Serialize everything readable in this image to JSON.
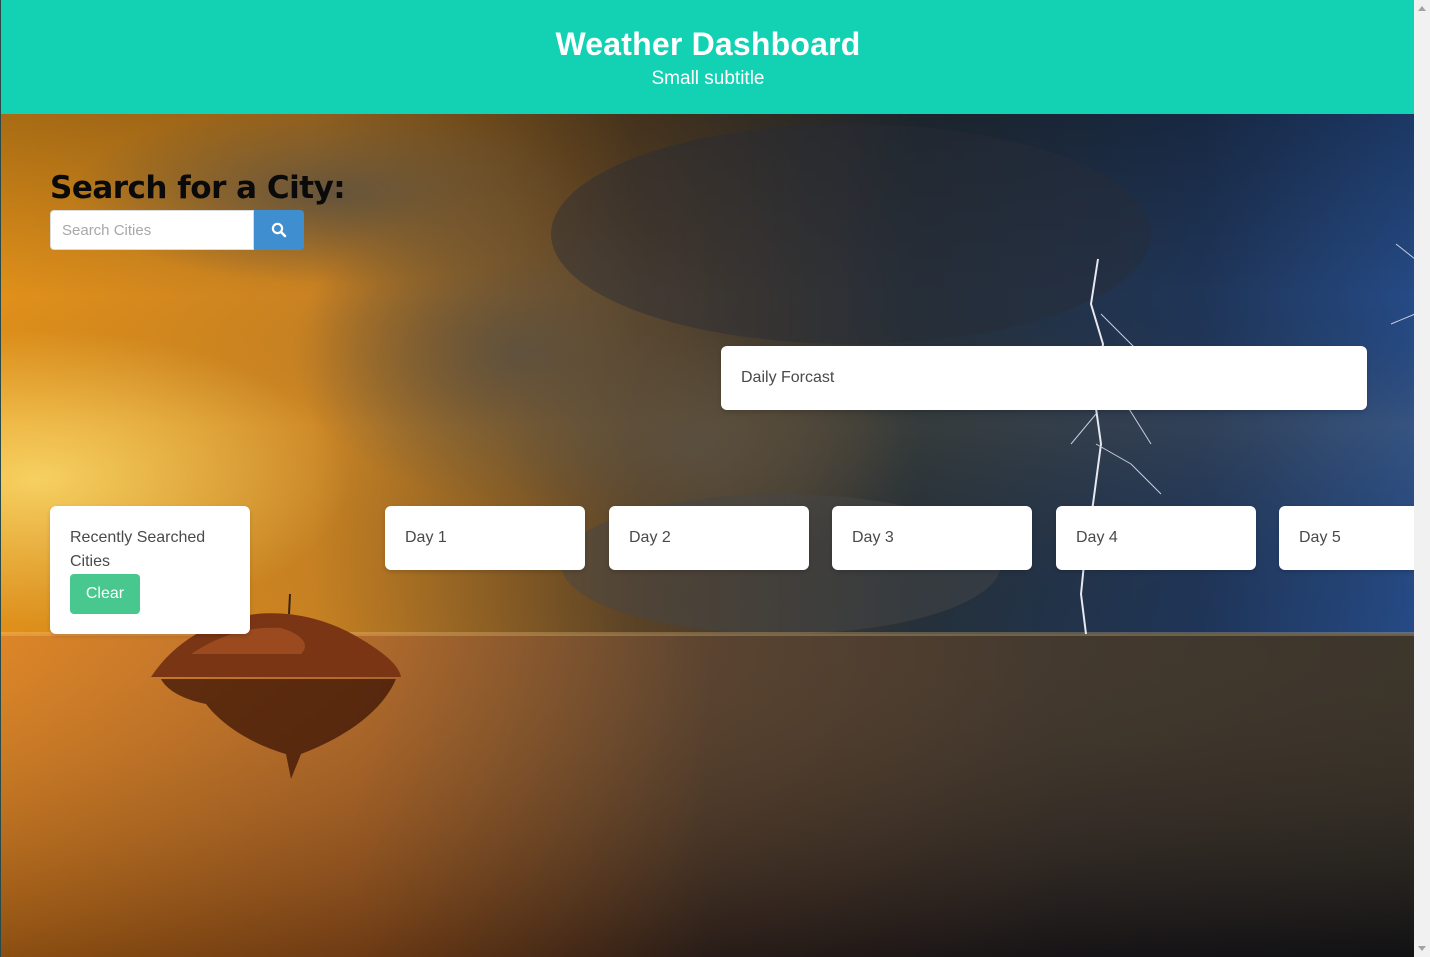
{
  "header": {
    "title": "Weather Dashboard",
    "subtitle": "Small subtitle"
  },
  "search": {
    "heading": "Search for a City:",
    "placeholder": "Search Cities",
    "button_icon": "search-icon"
  },
  "daily": {
    "label": "Daily Forcast"
  },
  "recent": {
    "label": "Recently Searched Cities",
    "clear_label": "Clear"
  },
  "forecast": {
    "days": [
      "Day 1",
      "Day 2",
      "Day 3",
      "Day 4",
      "Day 5"
    ]
  },
  "colors": {
    "header_bg": "#13d2b4",
    "search_button": "#3e8ed0",
    "clear_button": "#48c78e"
  }
}
